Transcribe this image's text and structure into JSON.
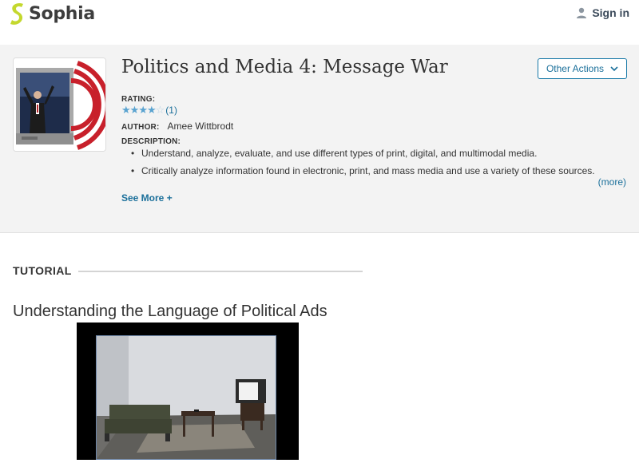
{
  "brand": {
    "name": "Sophia",
    "accent": "#c4d82e",
    "link_color": "#1a6f9a"
  },
  "nav": {
    "signin_label": "Sign in",
    "user_icon": "user-icon"
  },
  "resource": {
    "title": "Politics and Media 4: Message War",
    "other_actions_label": "Other Actions",
    "rating_label": "RATING:",
    "rating_value": 4,
    "rating_max": 5,
    "rating_count": "(1)",
    "author_label": "AUTHOR:",
    "author_name": "Amee Wittbrodt",
    "description_label": "DESCRIPTION:",
    "description_items": [
      "Understand, analyze, evaluate, and use different types of print, digital, and multimodal media.",
      "Critically analyze information found in electronic, print, and mass media and use a variety of these sources."
    ],
    "more_label": "(more)",
    "see_more_label": "See More +"
  },
  "tutorial": {
    "section_label": "TUTORIAL",
    "title": "Understanding the Language of Political Ads"
  }
}
